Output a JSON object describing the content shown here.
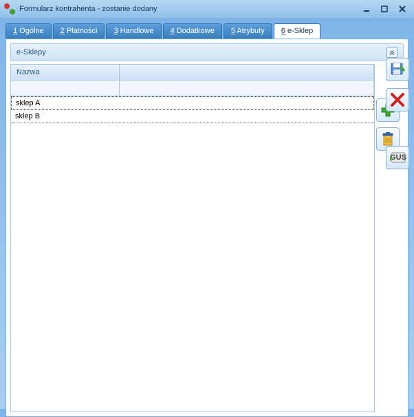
{
  "window": {
    "title": "Formularz kontrahenta - zostanie dodany"
  },
  "tabs": [
    {
      "num": "1",
      "label": "Ogólne"
    },
    {
      "num": "2",
      "label": "Płatności"
    },
    {
      "num": "3",
      "label": "Handlowe"
    },
    {
      "num": "4",
      "label": "Dodatkowe"
    },
    {
      "num": "5",
      "label": "Atrybuty"
    },
    {
      "num": "6",
      "label": "e-Sklep"
    }
  ],
  "active_tab": 5,
  "panel": {
    "group_title": "e-Sklepy",
    "column_header": "Nazwa",
    "rows": [
      {
        "name": "sklep A",
        "selected": true
      },
      {
        "name": "sklep B",
        "selected": false
      }
    ]
  }
}
